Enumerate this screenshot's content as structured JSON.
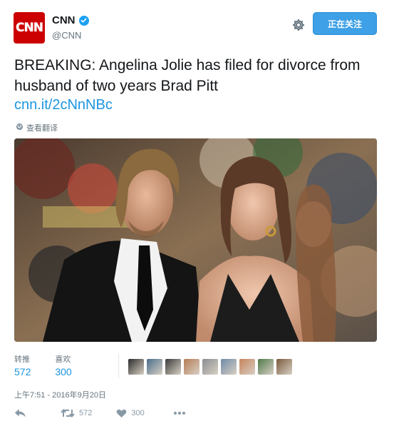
{
  "header": {
    "avatar_text": "CNN",
    "display_name": "CNN",
    "handle": "@CNN",
    "follow_label": "正在关注",
    "settings_icon": "gear-icon",
    "verified_icon": "verified-badge-icon"
  },
  "tweet": {
    "text": "BREAKING: Angelina Jolie has filed for divorce from husband of two years Brad Pitt",
    "link": "cnn.it/2cNnNBc",
    "translate_label": "查看翻译"
  },
  "stats": {
    "retweets_label": "转推",
    "retweets_count": "572",
    "likes_label": "喜欢",
    "likes_count": "300"
  },
  "likers": [
    {
      "name": "liker-1",
      "color": "#2b2b2b"
    },
    {
      "name": "liker-2",
      "color": "#4a6e8c"
    },
    {
      "name": "liker-3",
      "color": "#3b3b3b"
    },
    {
      "name": "liker-4",
      "color": "#b57c55"
    },
    {
      "name": "liker-5",
      "color": "#8a8d92"
    },
    {
      "name": "liker-6",
      "color": "#6f8aa6"
    },
    {
      "name": "liker-7",
      "color": "#c7835c"
    },
    {
      "name": "liker-8",
      "color": "#4f7a4a"
    },
    {
      "name": "liker-9",
      "color": "#7a5a3c"
    }
  ],
  "timestamp": "上午7:51 - 2016年9月20日",
  "actions": {
    "reply_icon": "reply-icon",
    "retweet_icon": "retweet-icon",
    "retweet_count": "572",
    "like_icon": "heart-icon",
    "like_count": "300",
    "more_icon": "more-icon"
  },
  "colors": {
    "brand": "#cc0000",
    "accent": "#1b95e0",
    "follow_bg": "#3ea0e6",
    "muted": "#66757f"
  }
}
